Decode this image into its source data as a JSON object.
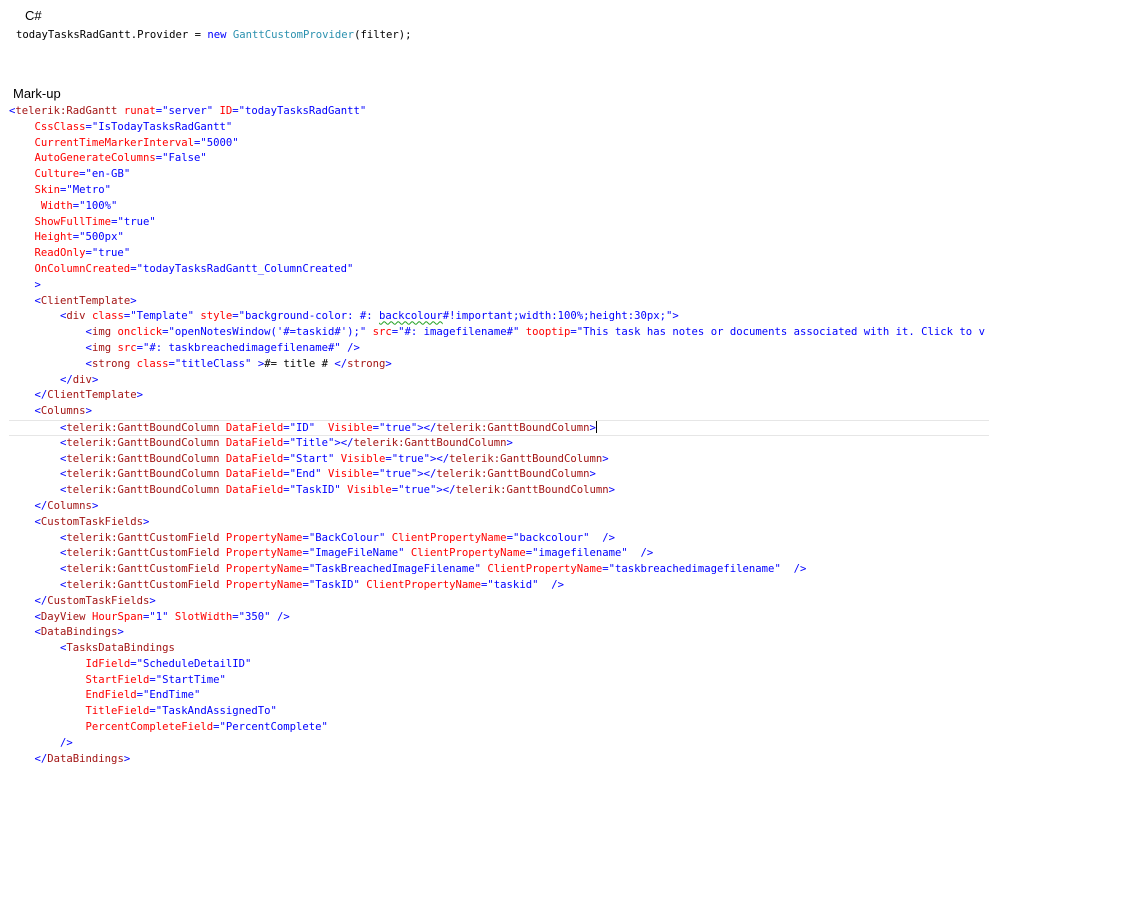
{
  "headings": {
    "csharp": "C#",
    "markup": "Mark-up"
  },
  "colors": {
    "tag": "#0000ff",
    "element": "#a31515",
    "attribute": "#ff0000",
    "value": "#0000ff",
    "text": "#000000",
    "type": "#2b91af",
    "keyword": "#0000ff",
    "squiggle": "#20a020"
  },
  "csharp_code": [
    [
      [
        "t",
        "todayTasksRadGantt.Provider = "
      ],
      [
        "k",
        "new"
      ],
      [
        "t",
        " "
      ],
      [
        "ty",
        "GanttCustomProvider"
      ],
      [
        "t",
        "(filter);"
      ]
    ]
  ],
  "markup_code": [
    [
      [
        "b",
        "<"
      ],
      [
        "r",
        "telerik:RadGantt"
      ],
      [
        "t",
        " "
      ],
      [
        "a",
        "runat"
      ],
      [
        "b",
        "=\"server\""
      ],
      [
        "t",
        " "
      ],
      [
        "a",
        "ID"
      ],
      [
        "b",
        "=\"todayTasksRadGantt\""
      ]
    ],
    [
      [
        "t",
        "    "
      ],
      [
        "a",
        "CssClass"
      ],
      [
        "b",
        "=\"IsTodayTasksRadGantt\""
      ]
    ],
    [
      [
        "t",
        "    "
      ],
      [
        "a",
        "CurrentTimeMarkerInterval"
      ],
      [
        "b",
        "=\"5000\""
      ]
    ],
    [
      [
        "t",
        "    "
      ],
      [
        "a",
        "AutoGenerateColumns"
      ],
      [
        "b",
        "=\"False\""
      ]
    ],
    [
      [
        "t",
        "    "
      ],
      [
        "a",
        "Culture"
      ],
      [
        "b",
        "=\"en-GB\""
      ]
    ],
    [
      [
        "t",
        "    "
      ],
      [
        "a",
        "Skin"
      ],
      [
        "b",
        "=\"Metro\""
      ]
    ],
    [
      [
        "t",
        "     "
      ],
      [
        "a",
        "Width"
      ],
      [
        "b",
        "=\"100%\""
      ]
    ],
    [
      [
        "t",
        "    "
      ],
      [
        "a",
        "ShowFullTime"
      ],
      [
        "b",
        "=\"true\""
      ]
    ],
    [
      [
        "t",
        "    "
      ],
      [
        "a",
        "Height"
      ],
      [
        "b",
        "=\"500px\""
      ]
    ],
    [
      [
        "t",
        "    "
      ],
      [
        "a",
        "ReadOnly"
      ],
      [
        "b",
        "=\"true\""
      ]
    ],
    [
      [
        "t",
        "    "
      ],
      [
        "a",
        "OnColumnCreated"
      ],
      [
        "b",
        "=\"todayTasksRadGantt_ColumnCreated\""
      ]
    ],
    [
      [
        "t",
        "    "
      ],
      [
        "b",
        ">"
      ]
    ],
    [
      [
        "t",
        "    "
      ],
      [
        "b",
        "<"
      ],
      [
        "r",
        "ClientTemplate"
      ],
      [
        "b",
        ">"
      ]
    ],
    [
      [
        "t",
        "        "
      ],
      [
        "b",
        "<"
      ],
      [
        "r",
        "div"
      ],
      [
        "t",
        " "
      ],
      [
        "a",
        "class"
      ],
      [
        "b",
        "=\"Template\""
      ],
      [
        "t",
        " "
      ],
      [
        "a",
        "style"
      ],
      [
        "b",
        "=\"background-color: #: "
      ],
      [
        "bs",
        "backcolour"
      ],
      [
        "b",
        "#!important;width:100%;height:30px;\""
      ],
      [
        "b",
        ">"
      ]
    ],
    [
      [
        "t",
        "            "
      ],
      [
        "b",
        "<"
      ],
      [
        "r",
        "img"
      ],
      [
        "t",
        " "
      ],
      [
        "a",
        "onclick"
      ],
      [
        "b",
        "=\"openNotesWindow('#=taskid#');\""
      ],
      [
        "t",
        " "
      ],
      [
        "a",
        "src"
      ],
      [
        "b",
        "=\"#: imagefilename#\""
      ],
      [
        "t",
        " "
      ],
      [
        "a",
        "tooptip"
      ],
      [
        "b",
        "=\"This task has notes or documents associated with it. Click to v"
      ]
    ],
    [
      [
        "t",
        "            "
      ],
      [
        "b",
        "<"
      ],
      [
        "r",
        "img"
      ],
      [
        "t",
        " "
      ],
      [
        "a",
        "src"
      ],
      [
        "b",
        "=\"#: taskbreachedimagefilename#\""
      ],
      [
        "t",
        " "
      ],
      [
        "b",
        "/>"
      ]
    ],
    [
      [
        "t",
        "            "
      ],
      [
        "b",
        "<"
      ],
      [
        "r",
        "strong"
      ],
      [
        "t",
        " "
      ],
      [
        "a",
        "class"
      ],
      [
        "b",
        "=\"titleClass\""
      ],
      [
        "t",
        " "
      ],
      [
        "b",
        ">"
      ],
      [
        "t",
        "#= title # "
      ],
      [
        "b",
        "</"
      ],
      [
        "r",
        "strong"
      ],
      [
        "b",
        ">"
      ]
    ],
    [
      [
        "t",
        "        "
      ],
      [
        "b",
        "</"
      ],
      [
        "r",
        "div"
      ],
      [
        "b",
        ">"
      ]
    ],
    [
      [
        "t",
        "    "
      ],
      [
        "b",
        "</"
      ],
      [
        "r",
        "ClientTemplate"
      ],
      [
        "b",
        ">"
      ]
    ],
    [
      [
        "t",
        "    "
      ],
      [
        "b",
        "<"
      ],
      [
        "r",
        "Columns"
      ],
      [
        "b",
        ">"
      ]
    ],
    [
      [
        "t",
        "        "
      ],
      [
        "b",
        "<"
      ],
      [
        "r",
        "telerik:GanttBoundColumn"
      ],
      [
        "t",
        " "
      ],
      [
        "a",
        "DataField"
      ],
      [
        "b",
        "=\"ID\""
      ],
      [
        "t",
        "  "
      ],
      [
        "a",
        "Visible"
      ],
      [
        "b",
        "=\"true\"></"
      ],
      [
        "r",
        "telerik:GanttBoundColumn"
      ],
      [
        "b",
        ">"
      ],
      [
        "caret",
        ""
      ]
    ],
    [
      [
        "t",
        "        "
      ],
      [
        "b",
        "<"
      ],
      [
        "r",
        "telerik:GanttBoundColumn"
      ],
      [
        "t",
        " "
      ],
      [
        "a",
        "DataField"
      ],
      [
        "b",
        "=\"Title\"></"
      ],
      [
        "r",
        "telerik:GanttBoundColumn"
      ],
      [
        "b",
        ">"
      ]
    ],
    [
      [
        "t",
        "        "
      ],
      [
        "b",
        "<"
      ],
      [
        "r",
        "telerik:GanttBoundColumn"
      ],
      [
        "t",
        " "
      ],
      [
        "a",
        "DataField"
      ],
      [
        "b",
        "=\"Start\""
      ],
      [
        "t",
        " "
      ],
      [
        "a",
        "Visible"
      ],
      [
        "b",
        "=\"true\"></"
      ],
      [
        "r",
        "telerik:GanttBoundColumn"
      ],
      [
        "b",
        ">"
      ]
    ],
    [
      [
        "t",
        "        "
      ],
      [
        "b",
        "<"
      ],
      [
        "r",
        "telerik:GanttBoundColumn"
      ],
      [
        "t",
        " "
      ],
      [
        "a",
        "DataField"
      ],
      [
        "b",
        "=\"End\""
      ],
      [
        "t",
        " "
      ],
      [
        "a",
        "Visible"
      ],
      [
        "b",
        "=\"true\"></"
      ],
      [
        "r",
        "telerik:GanttBoundColumn"
      ],
      [
        "b",
        ">"
      ]
    ],
    [
      [
        "t",
        "        "
      ],
      [
        "b",
        "<"
      ],
      [
        "r",
        "telerik:GanttBoundColumn"
      ],
      [
        "t",
        " "
      ],
      [
        "a",
        "DataField"
      ],
      [
        "b",
        "=\"TaskID\""
      ],
      [
        "t",
        " "
      ],
      [
        "a",
        "Visible"
      ],
      [
        "b",
        "=\"true\"></"
      ],
      [
        "r",
        "telerik:GanttBoundColumn"
      ],
      [
        "b",
        ">"
      ]
    ],
    [
      [
        "t",
        "    "
      ],
      [
        "b",
        "</"
      ],
      [
        "r",
        "Columns"
      ],
      [
        "b",
        ">"
      ]
    ],
    [
      [
        "t",
        "    "
      ],
      [
        "b",
        "<"
      ],
      [
        "r",
        "CustomTaskFields"
      ],
      [
        "b",
        ">"
      ]
    ],
    [
      [
        "t",
        "        "
      ],
      [
        "b",
        "<"
      ],
      [
        "r",
        "telerik:GanttCustomField"
      ],
      [
        "t",
        " "
      ],
      [
        "a",
        "PropertyName"
      ],
      [
        "b",
        "=\"BackColour\""
      ],
      [
        "t",
        " "
      ],
      [
        "a",
        "ClientPropertyName"
      ],
      [
        "b",
        "=\"backcolour\""
      ],
      [
        "t",
        "  "
      ],
      [
        "b",
        "/>"
      ]
    ],
    [
      [
        "t",
        "        "
      ],
      [
        "b",
        "<"
      ],
      [
        "r",
        "telerik:GanttCustomField"
      ],
      [
        "t",
        " "
      ],
      [
        "a",
        "PropertyName"
      ],
      [
        "b",
        "=\"ImageFileName\""
      ],
      [
        "t",
        " "
      ],
      [
        "a",
        "ClientPropertyName"
      ],
      [
        "b",
        "=\"imagefilename\""
      ],
      [
        "t",
        "  "
      ],
      [
        "b",
        "/>"
      ]
    ],
    [
      [
        "t",
        "        "
      ],
      [
        "b",
        "<"
      ],
      [
        "r",
        "telerik:GanttCustomField"
      ],
      [
        "t",
        " "
      ],
      [
        "a",
        "PropertyName"
      ],
      [
        "b",
        "=\"TaskBreachedImageFilename\""
      ],
      [
        "t",
        " "
      ],
      [
        "a",
        "ClientPropertyName"
      ],
      [
        "b",
        "=\"taskbreachedimagefilename\""
      ],
      [
        "t",
        "  "
      ],
      [
        "b",
        "/>"
      ]
    ],
    [
      [
        "t",
        "        "
      ],
      [
        "b",
        "<"
      ],
      [
        "r",
        "telerik:GanttCustomField"
      ],
      [
        "t",
        " "
      ],
      [
        "a",
        "PropertyName"
      ],
      [
        "b",
        "=\"TaskID\""
      ],
      [
        "t",
        " "
      ],
      [
        "a",
        "ClientPropertyName"
      ],
      [
        "b",
        "=\"taskid\""
      ],
      [
        "t",
        "  "
      ],
      [
        "b",
        "/>"
      ]
    ],
    [
      [
        "t",
        "    "
      ],
      [
        "b",
        "</"
      ],
      [
        "r",
        "CustomTaskFields"
      ],
      [
        "b",
        ">"
      ]
    ],
    [
      [
        "t",
        "    "
      ],
      [
        "b",
        "<"
      ],
      [
        "r",
        "DayView"
      ],
      [
        "t",
        " "
      ],
      [
        "a",
        "HourSpan"
      ],
      [
        "b",
        "=\"1\""
      ],
      [
        "t",
        " "
      ],
      [
        "a",
        "SlotWidth"
      ],
      [
        "b",
        "=\"350\""
      ],
      [
        "t",
        " "
      ],
      [
        "b",
        "/>"
      ]
    ],
    [
      [
        "t",
        "    "
      ],
      [
        "b",
        "<"
      ],
      [
        "r",
        "DataBindings"
      ],
      [
        "b",
        ">"
      ]
    ],
    [
      [
        "t",
        "        "
      ],
      [
        "b",
        "<"
      ],
      [
        "r",
        "TasksDataBindings"
      ]
    ],
    [
      [
        "t",
        "            "
      ],
      [
        "a",
        "IdField"
      ],
      [
        "b",
        "=\"ScheduleDetailID\""
      ]
    ],
    [
      [
        "t",
        "            "
      ],
      [
        "a",
        "StartField"
      ],
      [
        "b",
        "=\"StartTime\""
      ]
    ],
    [
      [
        "t",
        "            "
      ],
      [
        "a",
        "EndField"
      ],
      [
        "b",
        "=\"EndTime\""
      ]
    ],
    [
      [
        "t",
        "            "
      ],
      [
        "a",
        "TitleField"
      ],
      [
        "b",
        "=\"TaskAndAssignedTo\""
      ]
    ],
    [
      [
        "t",
        "            "
      ],
      [
        "a",
        "PercentCompleteField"
      ],
      [
        "b",
        "=\"PercentComplete\""
      ]
    ],
    [
      [
        "t",
        "        "
      ],
      [
        "b",
        "/>"
      ]
    ],
    [
      [
        "t",
        "    "
      ],
      [
        "b",
        "</"
      ],
      [
        "r",
        "DataBindings"
      ],
      [
        "b",
        ">"
      ]
    ]
  ]
}
